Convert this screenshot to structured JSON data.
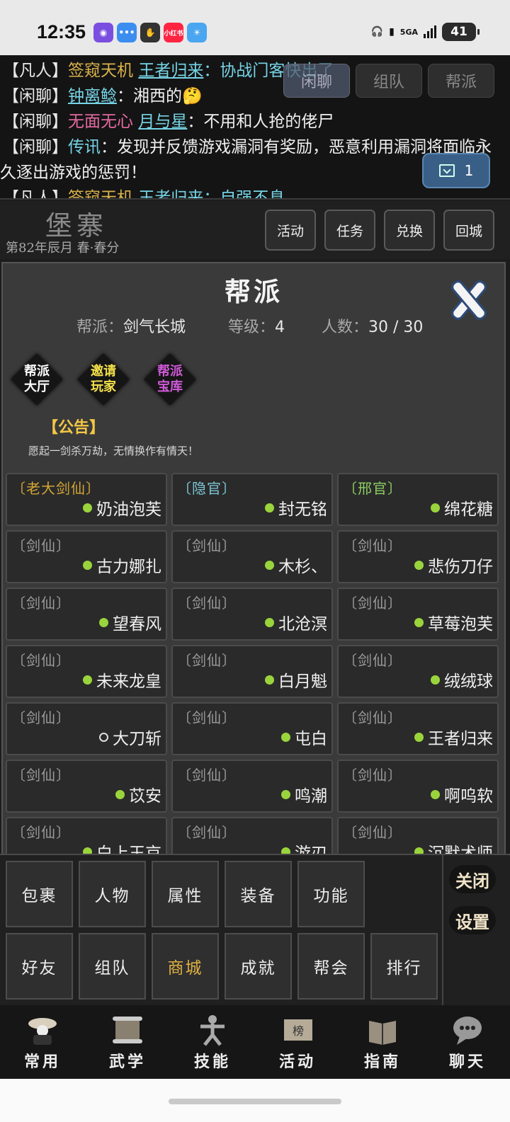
{
  "status_bar": {
    "time": "12:35",
    "network": "5GA",
    "battery": "41",
    "app_badge": "小红书"
  },
  "chat": {
    "tabs": [
      "闲聊",
      "组队",
      "帮派"
    ],
    "active_tab": "闲聊",
    "unread_count": "1",
    "lines": [
      {
        "channel": "凡人",
        "prefix": "签窥天机",
        "name": "王者归来",
        "text": "：协战门客快出了"
      },
      {
        "channel": "闲聊",
        "name": "钟离鲶",
        "text": "：湘西的🤔"
      },
      {
        "channel": "闲聊",
        "prefix": "无面无心",
        "name": "月与星",
        "text": "：不用和人抢的佬尸"
      },
      {
        "channel": "闲聊",
        "prefix": "传讯",
        "text": "：发现并反馈游戏漏洞有奖励，恶意利用漏洞将面临永久逐出游戏的惩罚！"
      },
      {
        "channel": "凡人",
        "prefix": "签窥天机",
        "name": "王者归来",
        "text": "：自强不息"
      }
    ]
  },
  "location": {
    "title": "堡寨",
    "date": "第82年辰月  春·春分",
    "buttons": [
      "活动",
      "任务",
      "兑换",
      "回城"
    ]
  },
  "guild_panel": {
    "title": "帮派",
    "name_label": "帮派：",
    "name": "剑气长城",
    "level_label": "等级：",
    "level": "4",
    "count_label": "人数：",
    "count": "30 / 30",
    "actions": [
      {
        "label": "帮派\n大厅",
        "color": "#ffffff"
      },
      {
        "label": "邀请\n玩家",
        "color": "#f3e04a"
      },
      {
        "label": "帮派\n宝库",
        "color": "#d05ad8"
      }
    ],
    "notice_title": "【公告】",
    "notice_text": "愿起一剑杀万劫，无情换作有情天！",
    "members": [
      {
        "rank": "〔老大剑仙〕",
        "rank_style": "gold",
        "name": "奶油泡芙",
        "online": true
      },
      {
        "rank": "〔隐官〕",
        "rank_style": "cyan",
        "name": "封无铭",
        "online": true
      },
      {
        "rank": "〔邢官〕",
        "rank_style": "green",
        "name": "绵花糖",
        "online": true
      },
      {
        "rank": "〔剑仙〕",
        "rank_style": "",
        "name": "古力娜扎",
        "online": true
      },
      {
        "rank": "〔剑仙〕",
        "rank_style": "",
        "name": "木杉、",
        "online": true
      },
      {
        "rank": "〔剑仙〕",
        "rank_style": "",
        "name": "悲伤刀仔",
        "online": true
      },
      {
        "rank": "〔剑仙〕",
        "rank_style": "",
        "name": "望春风",
        "online": true
      },
      {
        "rank": "〔剑仙〕",
        "rank_style": "",
        "name": "北沧溟",
        "online": true
      },
      {
        "rank": "〔剑仙〕",
        "rank_style": "",
        "name": "草莓泡芙",
        "online": true
      },
      {
        "rank": "〔剑仙〕",
        "rank_style": "",
        "name": "未来龙皇",
        "online": true
      },
      {
        "rank": "〔剑仙〕",
        "rank_style": "",
        "name": "白月魁",
        "online": true
      },
      {
        "rank": "〔剑仙〕",
        "rank_style": "",
        "name": "绒绒球",
        "online": true
      },
      {
        "rank": "〔剑仙〕",
        "rank_style": "",
        "name": "大刀斩",
        "online": false
      },
      {
        "rank": "〔剑仙〕",
        "rank_style": "",
        "name": "屯白",
        "online": true
      },
      {
        "rank": "〔剑仙〕",
        "rank_style": "",
        "name": "王者归来",
        "online": true
      },
      {
        "rank": "〔剑仙〕",
        "rank_style": "",
        "name": "苡安",
        "online": true
      },
      {
        "rank": "〔剑仙〕",
        "rank_style": "",
        "name": "鸣潮",
        "online": true
      },
      {
        "rank": "〔剑仙〕",
        "rank_style": "",
        "name": "啊呜软",
        "online": true
      },
      {
        "rank": "〔剑仙〕",
        "rank_style": "",
        "name": "白上玉京",
        "online": true
      },
      {
        "rank": "〔剑仙〕",
        "rank_style": "",
        "name": "游刃",
        "online": true
      },
      {
        "rank": "〔剑仙〕",
        "rank_style": "",
        "name": "沉默术师",
        "online": true
      }
    ]
  },
  "menu": {
    "row1": [
      "包裹",
      "人物",
      "属性",
      "装备",
      "功能"
    ],
    "row2": [
      "好友",
      "组队",
      "商城",
      "成就",
      "帮会",
      "排行"
    ],
    "highlight": "商城",
    "side": [
      "关闭",
      "设置"
    ]
  },
  "nav": [
    "常用",
    "武学",
    "技能",
    "活动",
    "指南",
    "聊天"
  ]
}
